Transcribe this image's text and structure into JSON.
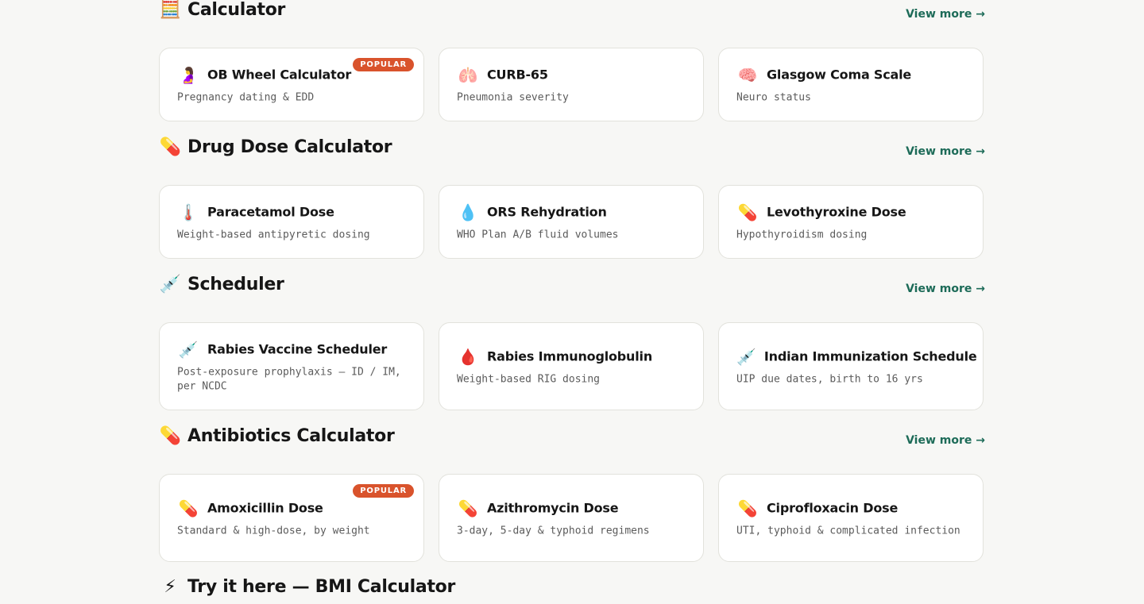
{
  "sections": [
    {
      "title": "Calculator",
      "icon": "abacus-icon",
      "emoji": "🧮",
      "view_more": "View more →",
      "cards": [
        {
          "emoji": "🤰",
          "icon": "pregnant-woman-icon",
          "title": "OB Wheel Calculator",
          "desc": "Pregnancy dating & EDD",
          "badge": "POPULAR"
        },
        {
          "emoji": "🫁",
          "icon": "lungs-icon",
          "title": "CURB-65",
          "desc": "Pneumonia severity",
          "badge": ""
        },
        {
          "emoji": "🧠",
          "icon": "brain-icon",
          "title": "Glasgow Coma Scale",
          "desc": "Neuro status",
          "badge": ""
        }
      ]
    },
    {
      "title": "Drug Dose Calculator",
      "icon": "pill-icon",
      "emoji": "💊",
      "view_more": "View more →",
      "cards": [
        {
          "emoji": "🌡️",
          "icon": "thermometer-icon",
          "title": "Paracetamol Dose",
          "desc": "Weight-based antipyretic dosing",
          "badge": ""
        },
        {
          "emoji": "💧",
          "icon": "droplet-icon",
          "title": "ORS Rehydration",
          "desc": "WHO Plan A/B fluid volumes",
          "badge": ""
        },
        {
          "emoji": "💊",
          "icon": "pill-icon",
          "title": "Levothyroxine Dose",
          "desc": "Hypothyroidism dosing",
          "badge": ""
        }
      ]
    },
    {
      "title": "Scheduler",
      "icon": "syringe-icon",
      "emoji": "💉",
      "view_more": "View more →",
      "cards": [
        {
          "emoji": "💉",
          "icon": "syringe-icon",
          "title": "Rabies Vaccine Scheduler",
          "desc": "Post-exposure prophylaxis — ID / IM, per NCDC",
          "badge": ""
        },
        {
          "emoji": "🩸",
          "icon": "blood-drop-icon",
          "title": "Rabies Immunoglobulin",
          "desc": "Weight-based RIG dosing",
          "badge": ""
        },
        {
          "emoji": "💉",
          "icon": "syringe-icon",
          "title": "Indian Immunization Schedule",
          "desc": "UIP due dates, birth to 16 yrs",
          "badge": ""
        }
      ]
    },
    {
      "title": "Antibiotics Calculator",
      "icon": "pill-icon",
      "emoji": "💊",
      "view_more": "View more →",
      "cards": [
        {
          "emoji": "💊",
          "icon": "pill-icon",
          "title": "Amoxicillin Dose",
          "desc": "Standard & high-dose, by weight",
          "badge": "POPULAR"
        },
        {
          "emoji": "💊",
          "icon": "pill-icon",
          "title": "Azithromycin Dose",
          "desc": "3-day, 5-day & typhoid regimens",
          "badge": ""
        },
        {
          "emoji": "💊",
          "icon": "pill-icon",
          "title": "Ciprofloxacin Dose",
          "desc": "UTI, typhoid & complicated infection",
          "badge": ""
        }
      ]
    },
    {
      "title": "Try it here — BMI Calculator",
      "icon": "lightning-icon",
      "emoji": "⚡",
      "view_more": "",
      "cards": []
    }
  ],
  "colors": {
    "background": "#f7f7f5",
    "accent": "#1d6b58",
    "badge": "#d9532c"
  }
}
